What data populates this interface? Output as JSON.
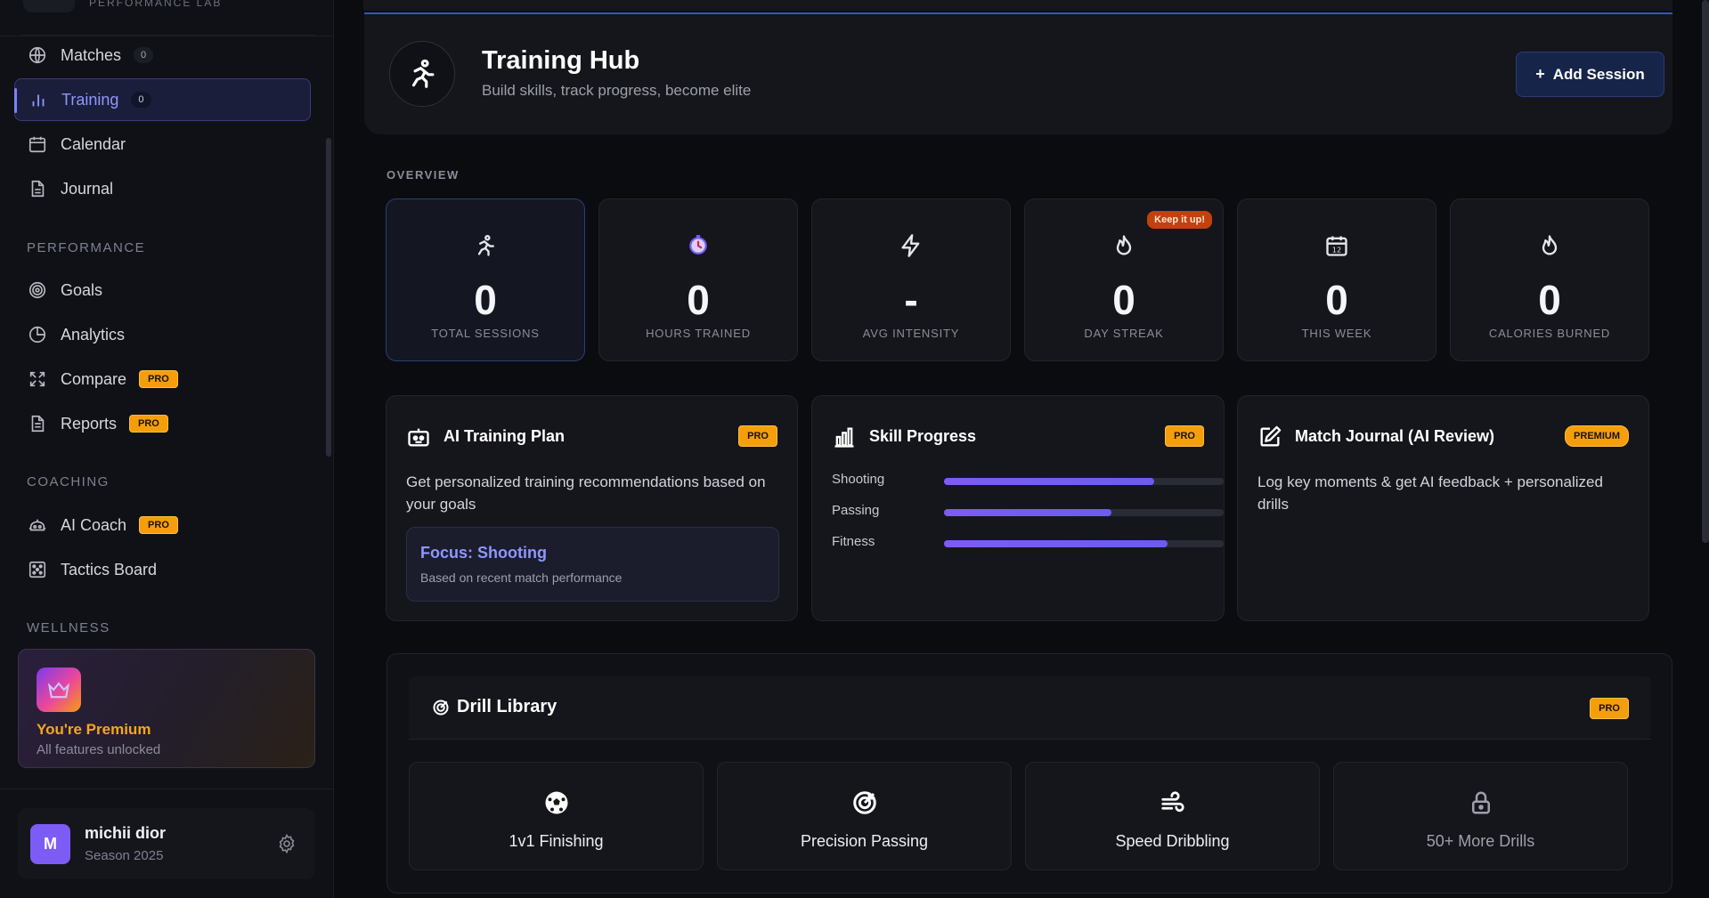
{
  "brand": {
    "subtitle": "PERFORMANCE LAB"
  },
  "sidebar": {
    "items": [
      {
        "label": "Matches",
        "count": "0"
      },
      {
        "label": "Training",
        "count": "0"
      },
      {
        "label": "Calendar"
      },
      {
        "label": "Journal"
      },
      {
        "label": "Goals"
      },
      {
        "label": "Analytics"
      },
      {
        "label": "Compare",
        "badge": "PRO"
      },
      {
        "label": "Reports",
        "badge": "PRO"
      },
      {
        "label": "AI Coach",
        "badge": "PRO"
      },
      {
        "label": "Tactics Board"
      }
    ],
    "sections": {
      "performance": "PERFORMANCE",
      "coaching": "COACHING",
      "wellness": "WELLNESS"
    },
    "premium": {
      "title": "You're Premium",
      "subtitle": "All features unlocked"
    },
    "user": {
      "initial": "M",
      "name": "michii dior",
      "season": "Season 2025"
    }
  },
  "hero": {
    "title": "Training Hub",
    "subtitle": "Build skills, track progress, become elite",
    "add_button": "Add Session"
  },
  "overview": {
    "label": "OVERVIEW",
    "stats": [
      {
        "value": "0",
        "label": "TOTAL SESSIONS",
        "icon": "runner-icon"
      },
      {
        "value": "0",
        "label": "HOURS TRAINED",
        "icon": "stopwatch-icon"
      },
      {
        "value": "-",
        "label": "AVG INTENSITY",
        "icon": "lightning-icon"
      },
      {
        "value": "0",
        "label": "DAY STREAK",
        "icon": "flame-icon",
        "badge": "Keep it up!"
      },
      {
        "value": "0",
        "label": "THIS WEEK",
        "icon": "calendar-icon"
      },
      {
        "value": "0",
        "label": "CALORIES BURNED",
        "icon": "flame-icon"
      }
    ]
  },
  "cards": {
    "ai_plan": {
      "title": "AI Training Plan",
      "badge": "PRO",
      "text": "Get personalized training recommendations based on your goals",
      "focus_title": "Focus: Shooting",
      "focus_sub": "Based on recent match performance"
    },
    "skill_progress": {
      "title": "Skill Progress",
      "badge": "PRO",
      "skills": [
        {
          "name": "Shooting",
          "percent": 75
        },
        {
          "name": "Passing",
          "percent": 60
        },
        {
          "name": "Fitness",
          "percent": 80
        }
      ]
    },
    "match_journal": {
      "title": "Match Journal (AI Review)",
      "badge": "PREMIUM",
      "text": "Log key moments & get AI feedback + personalized drills"
    }
  },
  "drills": {
    "title": "Drill Library",
    "badge": "PRO",
    "items": [
      {
        "label": "1v1 Finishing",
        "icon": "soccer-ball-icon"
      },
      {
        "label": "Precision Passing",
        "icon": "target-icon"
      },
      {
        "label": "Speed Dribbling",
        "icon": "wind-icon"
      },
      {
        "label": "50+ More Drills",
        "icon": "lock-icon"
      }
    ]
  },
  "colors": {
    "accent": "#7b83ff",
    "pro": "#f59e0b",
    "streak": "#c2410c",
    "premium_title": "#f5a623"
  }
}
